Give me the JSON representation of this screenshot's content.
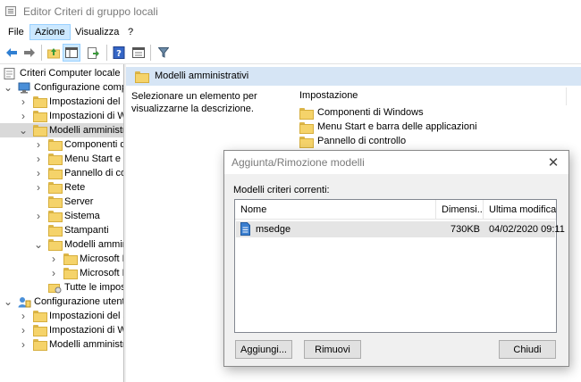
{
  "window": {
    "title": "Editor Criteri di gruppo locali"
  },
  "menubar": {
    "items": [
      "File",
      "Azione",
      "Visualizza",
      "?"
    ],
    "active_index": 1
  },
  "toolbar": {
    "buttons": [
      "back-icon",
      "forward-icon",
      "up-folder-icon",
      "show-hide-tree-icon",
      "export-list-icon",
      "help-icon",
      "properties-icon",
      "filter-icon"
    ]
  },
  "tree": {
    "items": [
      {
        "label": "Criteri Computer locale",
        "level": 0,
        "arrow": "",
        "icon": "policy-icon"
      },
      {
        "label": "Configurazione computer",
        "level": 0,
        "arrow": "down",
        "icon": "computer-icon"
      },
      {
        "label": "Impostazioni del software",
        "level": 1,
        "arrow": "right",
        "icon": "folder-icon"
      },
      {
        "label": "Impostazioni di Windows",
        "level": 1,
        "arrow": "right",
        "icon": "folder-icon"
      },
      {
        "label": "Modelli amministrativi",
        "level": 1,
        "arrow": "down",
        "icon": "folder-icon",
        "selected": true
      },
      {
        "label": "Componenti di Windows",
        "level": 2,
        "arrow": "right",
        "icon": "folder-icon"
      },
      {
        "label": "Menu Start e barra delle applicazioni",
        "level": 2,
        "arrow": "right",
        "icon": "folder-icon"
      },
      {
        "label": "Pannello di controllo",
        "level": 2,
        "arrow": "right",
        "icon": "folder-icon"
      },
      {
        "label": "Rete",
        "level": 2,
        "arrow": "right",
        "icon": "folder-icon"
      },
      {
        "label": "Server",
        "level": 2,
        "arrow": "",
        "icon": "folder-icon"
      },
      {
        "label": "Sistema",
        "level": 2,
        "arrow": "right",
        "icon": "folder-icon"
      },
      {
        "label": "Stampanti",
        "level": 2,
        "arrow": "",
        "icon": "folder-icon"
      },
      {
        "label": "Modelli amministrativi",
        "level": 2,
        "arrow": "down",
        "icon": "folder-icon"
      },
      {
        "label": "Microsoft Edge",
        "level": 3,
        "arrow": "right",
        "icon": "folder-icon"
      },
      {
        "label": "Microsoft Edge",
        "level": 3,
        "arrow": "right",
        "icon": "folder-icon"
      },
      {
        "label": "Tutte le impostazioni",
        "level": 2,
        "arrow": "",
        "icon": "settings-folder-icon"
      },
      {
        "label": "Configurazione utente",
        "level": 0,
        "arrow": "down",
        "icon": "user-icon"
      },
      {
        "label": "Impostazioni del software",
        "level": 1,
        "arrow": "right",
        "icon": "folder-icon"
      },
      {
        "label": "Impostazioni di Windows",
        "level": 1,
        "arrow": "right",
        "icon": "folder-icon"
      },
      {
        "label": "Modelli amministrativi",
        "level": 1,
        "arrow": "right",
        "icon": "folder-icon"
      }
    ]
  },
  "main": {
    "header": "Modelli amministrativi",
    "description": "Selezionare un elemento per visualizzarne la descrizione.",
    "column_header": "Impostazione",
    "settings": [
      "Componenti di Windows",
      "Menu Start e barra delle applicazioni",
      "Pannello di controllo"
    ]
  },
  "dialog": {
    "title": "Aggiunta/Rimozione modelli",
    "label": "Modelli criteri correnti:",
    "columns": [
      "Nome",
      "Dimensi...",
      "Ultima modifica"
    ],
    "rows": [
      {
        "name": "msedge",
        "size": "730KB",
        "modified": "04/02/2020 09:11",
        "icon": "adm-file-icon"
      }
    ],
    "buttons": {
      "add": "Aggiungi...",
      "remove": "Rimuovi",
      "close": "Chiudi"
    }
  },
  "colors": {
    "selection": "#cce8ff",
    "pane_header": "#d6e5f5",
    "tree_selected": "#d9d9d9"
  }
}
